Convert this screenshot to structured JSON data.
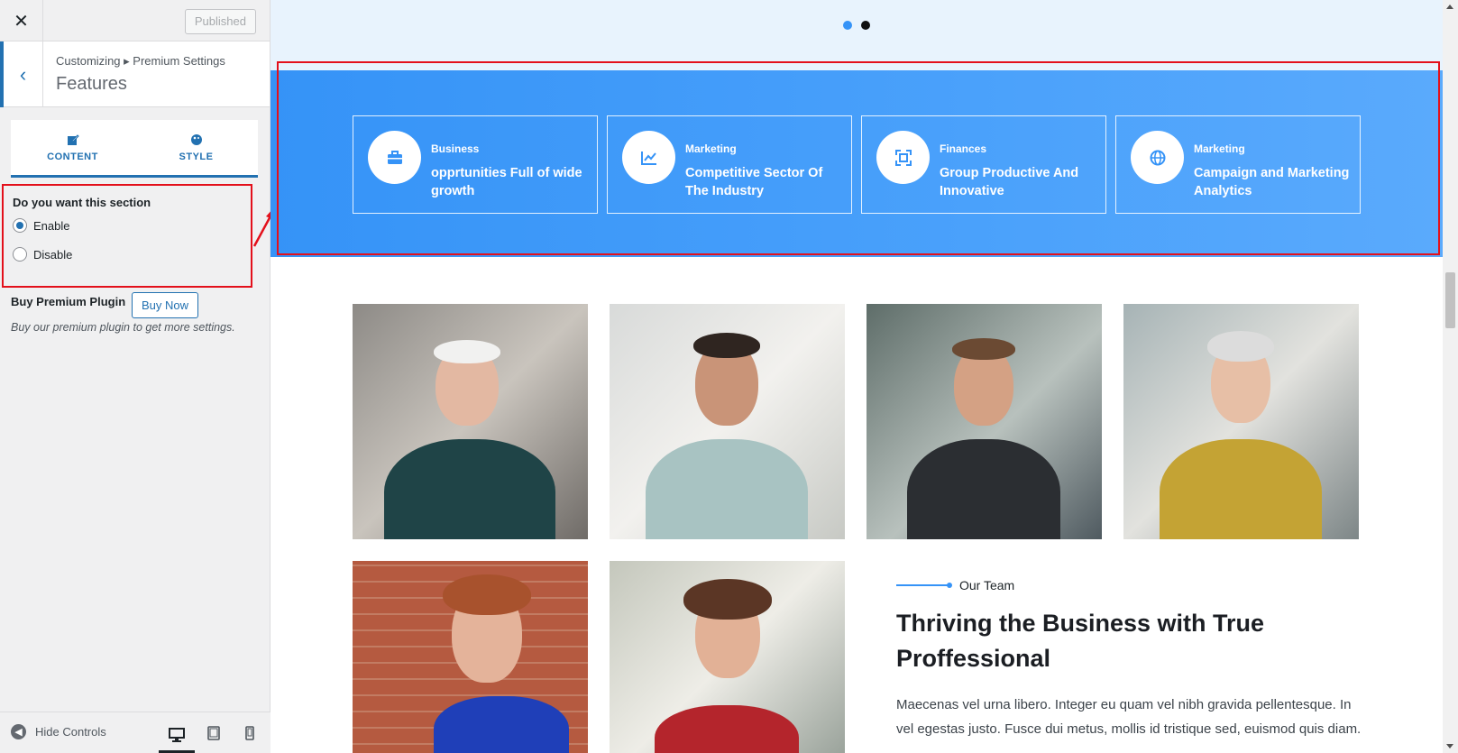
{
  "sidebar": {
    "close_icon": "close-icon",
    "publish_label": "Published",
    "breadcrumb": "Customizing ▸ Premium Settings",
    "section_title": "Features",
    "tabs": [
      {
        "label": "CONTENT",
        "icon": "edit-icon"
      },
      {
        "label": "STYLE",
        "icon": "palette-icon"
      }
    ],
    "section_question": "Do you want this section",
    "options": [
      {
        "label": "Enable",
        "checked": true
      },
      {
        "label": "Disable",
        "checked": false
      }
    ],
    "buy_label": "Buy Premium Plugin",
    "buy_button": "Buy Now",
    "buy_description": "Buy our premium plugin to get more settings.",
    "hide_controls": "Hide Controls",
    "devices": [
      "desktop-icon",
      "tablet-icon",
      "mobile-icon"
    ]
  },
  "preview": {
    "features": [
      {
        "category": "Business",
        "title": "opprtunities Full of wide growth",
        "icon": "briefcase-icon"
      },
      {
        "category": "Marketing",
        "title": "Competitive Sector Of The Industry",
        "icon": "chart-icon"
      },
      {
        "category": "Finances",
        "title": "Group Productive And Innovative",
        "icon": "focus-icon"
      },
      {
        "category": "Marketing",
        "title": "Campaign and Marketing Analytics",
        "icon": "globe-icon"
      }
    ],
    "team": {
      "tag": "Our Team",
      "heading": "Thriving the Business with True Proffessional",
      "paragraph": "Maecenas vel urna libero. Integer eu quam vel nibh gravida pellentesque. In vel egestas justo. Fusce dui metus, mollis id tristique sed, euismod quis diam."
    }
  },
  "colors": {
    "accent": "#2271b1",
    "feature_band": "#3593f7",
    "highlight": "#e3101b"
  }
}
